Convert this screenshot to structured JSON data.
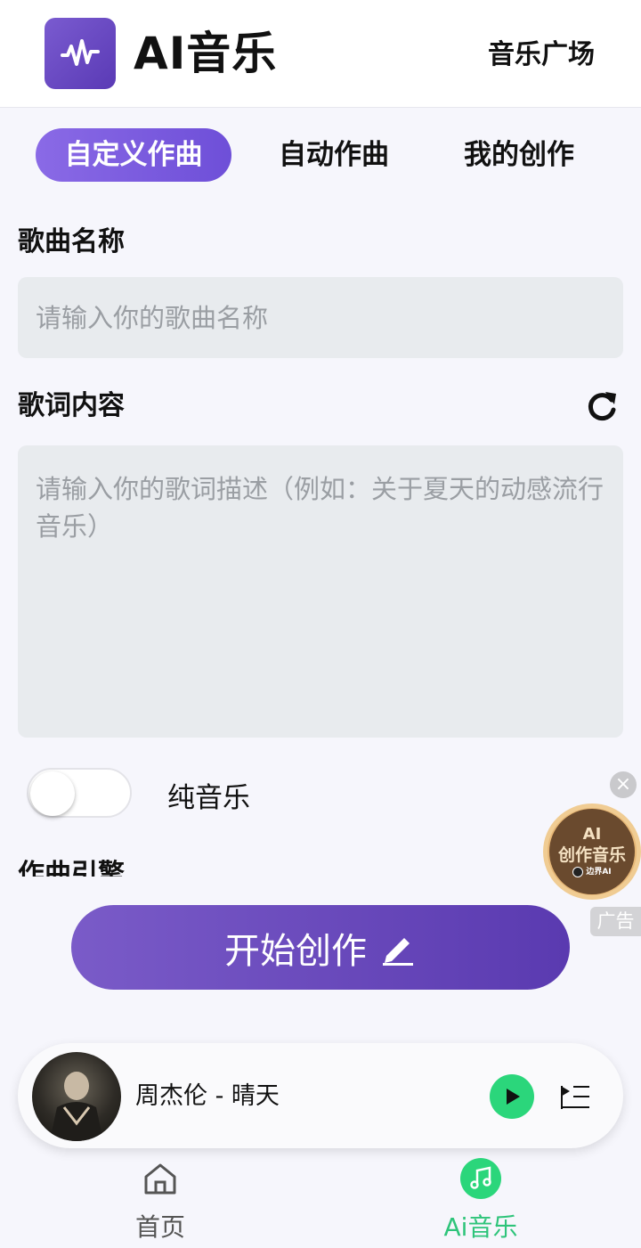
{
  "header": {
    "app_title": "AI音乐",
    "plaza_link": "音乐广场"
  },
  "tabs": [
    {
      "label": "自定义作曲",
      "active": true
    },
    {
      "label": "自动作曲",
      "active": false
    },
    {
      "label": "我的创作",
      "active": false
    }
  ],
  "form": {
    "song_name_label": "歌曲名称",
    "song_name_placeholder": "请输入你的歌曲名称",
    "lyrics_label": "歌词内容",
    "lyrics_placeholder": "请输入你的歌词描述（例如：关于夏天的动感流行音乐）",
    "pure_music_label": "纯音乐",
    "pure_music_on": false,
    "engine_label": "作曲引擎",
    "start_button": "开始创作"
  },
  "ad": {
    "line1": "AI",
    "line2": "创作音乐",
    "brand": "边界AI",
    "tag": "广告",
    "close": "×"
  },
  "player": {
    "song": "周杰伦 - 晴天"
  },
  "nav": [
    {
      "label": "首页",
      "icon": "home-icon",
      "active": false
    },
    {
      "label": "Ai音乐",
      "icon": "music-note-icon",
      "active": true
    }
  ],
  "colors": {
    "accent": "#7a5bd0",
    "active_green": "#2bd67b",
    "nav_active_text": "#2ec47a"
  }
}
